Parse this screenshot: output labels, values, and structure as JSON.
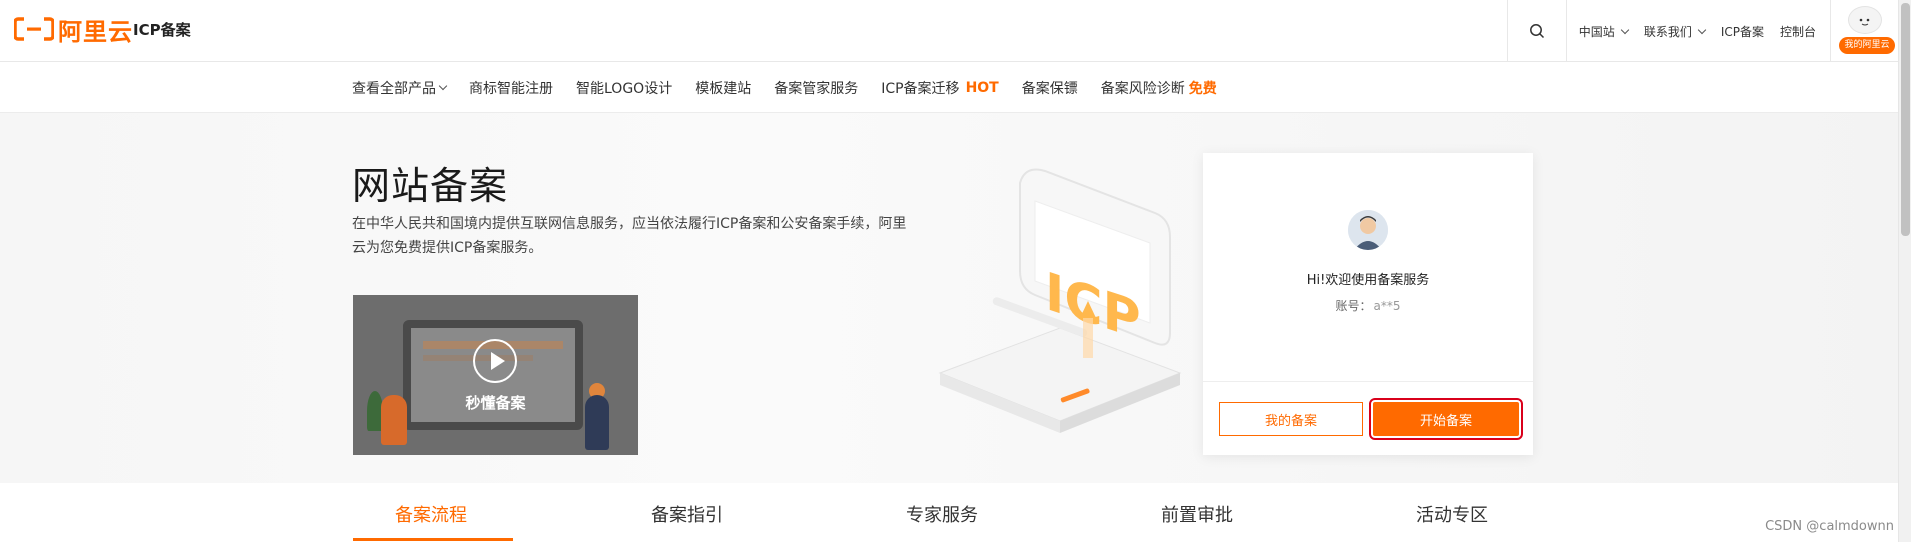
{
  "header": {
    "logo_text": "阿里云",
    "product_name": "ICP备案",
    "links": [
      {
        "label": "中国站",
        "has_dropdown": true
      },
      {
        "label": "联系我们",
        "has_dropdown": true
      },
      {
        "label": "ICP备案",
        "has_dropdown": false
      },
      {
        "label": "控制台",
        "has_dropdown": false
      }
    ],
    "user_badge": "我的阿里云"
  },
  "subnav": {
    "all_products": "查看全部产品",
    "items": [
      "商标智能注册",
      "智能LOGO设计",
      "模板建站",
      "备案管家服务"
    ],
    "migration": "ICP备案迁移",
    "hot_badge": "HOT",
    "guard": "备案保镖",
    "risk": "备案风险诊断",
    "free_badge": "免费"
  },
  "hero": {
    "title": "网站备案",
    "description": "在中华人民共和国境内提供互联网信息服务，应当依法履行ICP备案和公安备案手续，阿里云为您免费提供ICP备案服务。",
    "video_label": "秒懂备案",
    "illustration_text": "ICP"
  },
  "card": {
    "welcome": "Hi!欢迎使用备案服务",
    "account_label": "账号：",
    "account_value": "a**5",
    "my_filing_button": "我的备案",
    "start_filing_button": "开始备案"
  },
  "tabs": [
    {
      "label": "备案流程",
      "active": true
    },
    {
      "label": "备案指引",
      "active": false
    },
    {
      "label": "专家服务",
      "active": false
    },
    {
      "label": "前置审批",
      "active": false
    },
    {
      "label": "活动专区",
      "active": false
    }
  ],
  "watermark": "CSDN @calmdownn",
  "colors": {
    "accent": "#ff6a00",
    "highlight_outline": "#d9001b"
  }
}
